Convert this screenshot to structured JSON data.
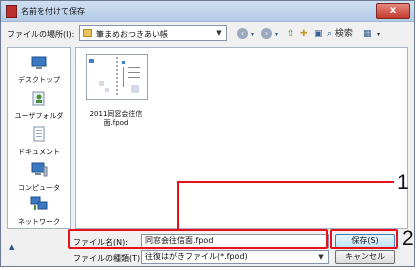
{
  "window": {
    "title": "名前を付けて保存",
    "close_label": "x"
  },
  "address_bar": {
    "label": "ファイルの場所(I):",
    "value": "筆まめおつきあい帳"
  },
  "toolbar": {
    "back_icon": "back-icon",
    "forward_icon": "forward-icon",
    "search_label": "検索"
  },
  "sidebar": {
    "items": [
      {
        "label": "デスクトップ",
        "icon": "desktop-icon"
      },
      {
        "label": "ユーザフォルダ",
        "icon": "user-folder-icon"
      },
      {
        "label": "ドキュメント",
        "icon": "documents-icon"
      },
      {
        "label": "コンピュータ",
        "icon": "computer-icon"
      },
      {
        "label": "ネットワーク",
        "icon": "network-icon"
      }
    ]
  },
  "files": [
    {
      "name": "2011同窓会往信面.fpod"
    }
  ],
  "filename": {
    "label": "ファイル名(N):",
    "value": "同窓会往信面.fpod"
  },
  "filetype": {
    "label": "ファイルの種類(T):",
    "value": "往復はがきファイル(*.fpod)"
  },
  "buttons": {
    "save": "保存(S)",
    "cancel": "キャンセル"
  },
  "annotations": {
    "callout_1": "1",
    "callout_2": "2"
  },
  "colors": {
    "callout": "#e8101b",
    "titlebar": "#cfe0f3"
  }
}
